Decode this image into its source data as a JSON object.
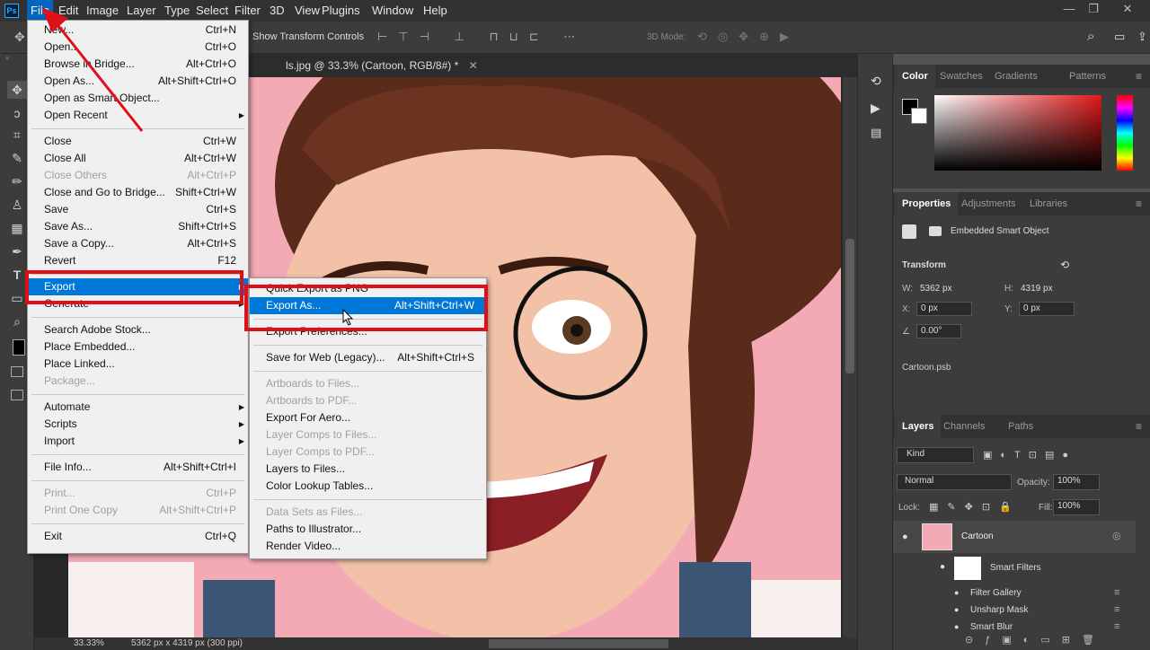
{
  "app": {
    "logo": "Ps"
  },
  "menubar": [
    "File",
    "Edit",
    "Image",
    "Layer",
    "Type",
    "Select",
    "Filter",
    "3D",
    "View",
    "Plugins",
    "Window",
    "Help"
  ],
  "window_controls": [
    "—",
    "❐",
    "✕"
  ],
  "options_bar": {
    "show_transform": "Show Transform Controls",
    "mode_3d": "3D Mode:"
  },
  "document": {
    "tab_title": "ls.jpg @ 33.3% (Cartoon, RGB/8#) *",
    "close": "✕"
  },
  "status": {
    "zoom": "33.33%",
    "info": "5362 px x 4319 px (300 ppi)"
  },
  "file_menu": [
    {
      "label": "New...",
      "shortcut": "Ctrl+N"
    },
    {
      "label": "Open...",
      "shortcut": "Ctrl+O"
    },
    {
      "label": "Browse in Bridge...",
      "shortcut": "Alt+Ctrl+O"
    },
    {
      "label": "Open As...",
      "shortcut": "Alt+Shift+Ctrl+O"
    },
    {
      "label": "Open as Smart Object...",
      "shortcut": ""
    },
    {
      "label": "Open Recent",
      "shortcut": "",
      "submenu": true
    },
    {
      "sep": true
    },
    {
      "label": "Close",
      "shortcut": "Ctrl+W"
    },
    {
      "label": "Close All",
      "shortcut": "Alt+Ctrl+W"
    },
    {
      "label": "Close Others",
      "shortcut": "Alt+Ctrl+P",
      "disabled": true
    },
    {
      "label": "Close and Go to Bridge...",
      "shortcut": "Shift+Ctrl+W"
    },
    {
      "label": "Save",
      "shortcut": "Ctrl+S"
    },
    {
      "label": "Save As...",
      "shortcut": "Shift+Ctrl+S"
    },
    {
      "label": "Save a Copy...",
      "shortcut": "Alt+Ctrl+S"
    },
    {
      "label": "Revert",
      "shortcut": "F12"
    },
    {
      "sep": true
    },
    {
      "label": "Export",
      "shortcut": "",
      "submenu": true,
      "highlighted": true
    },
    {
      "label": "Generate",
      "shortcut": "",
      "submenu": true
    },
    {
      "sep": true
    },
    {
      "label": "Search Adobe Stock...",
      "shortcut": ""
    },
    {
      "label": "Place Embedded...",
      "shortcut": ""
    },
    {
      "label": "Place Linked...",
      "shortcut": ""
    },
    {
      "label": "Package...",
      "shortcut": "",
      "disabled": true
    },
    {
      "sep": true
    },
    {
      "label": "Automate",
      "shortcut": "",
      "submenu": true
    },
    {
      "label": "Scripts",
      "shortcut": "",
      "submenu": true
    },
    {
      "label": "Import",
      "shortcut": "",
      "submenu": true
    },
    {
      "sep": true
    },
    {
      "label": "File Info...",
      "shortcut": "Alt+Shift+Ctrl+I"
    },
    {
      "sep": true
    },
    {
      "label": "Print...",
      "shortcut": "Ctrl+P",
      "disabled": true
    },
    {
      "label": "Print One Copy",
      "shortcut": "Alt+Shift+Ctrl+P",
      "disabled": true
    },
    {
      "sep": true
    },
    {
      "label": "Exit",
      "shortcut": "Ctrl+Q"
    }
  ],
  "export_menu": [
    {
      "label": "Quick Export as PNG",
      "shortcut": ""
    },
    {
      "label": "Export As...",
      "shortcut": "Alt+Shift+Ctrl+W",
      "highlighted": true
    },
    {
      "sep": true
    },
    {
      "label": "Export Preferences...",
      "shortcut": ""
    },
    {
      "sep": true
    },
    {
      "label": "Save for Web (Legacy)...",
      "shortcut": "Alt+Shift+Ctrl+S"
    },
    {
      "sep": true
    },
    {
      "label": "Artboards to Files...",
      "shortcut": "",
      "disabled": true
    },
    {
      "label": "Artboards to PDF...",
      "shortcut": "",
      "disabled": true
    },
    {
      "label": "Export For Aero...",
      "shortcut": ""
    },
    {
      "label": "Layer Comps to Files...",
      "shortcut": "",
      "disabled": true
    },
    {
      "label": "Layer Comps to PDF...",
      "shortcut": "",
      "disabled": true
    },
    {
      "label": "Layers to Files...",
      "shortcut": ""
    },
    {
      "label": "Color Lookup Tables...",
      "shortcut": ""
    },
    {
      "sep": true
    },
    {
      "label": "Data Sets as Files...",
      "shortcut": "",
      "disabled": true
    },
    {
      "label": "Paths to Illustrator...",
      "shortcut": ""
    },
    {
      "label": "Render Video...",
      "shortcut": ""
    }
  ],
  "color_panel": {
    "tabs": [
      "Color",
      "Swatches",
      "Gradients",
      "Patterns"
    ]
  },
  "properties_panel": {
    "tabs": [
      "Properties",
      "Adjustments",
      "Libraries"
    ],
    "type": "Embedded Smart Object",
    "transform_title": "Transform",
    "w_label": "W:",
    "w_value": "5362 px",
    "h_label": "H:",
    "h_value": "4319 px",
    "x_label": "X:",
    "x_value": "0 px",
    "y_label": "Y:",
    "y_value": "0 px",
    "angle_value": "0.00°",
    "file": "Cartoon.psb"
  },
  "layers_panel": {
    "tabs": [
      "Layers",
      "Channels",
      "Paths"
    ],
    "filter": "Kind",
    "blend_mode": "Normal",
    "opacity_label": "Opacity:",
    "opacity_value": "100%",
    "lock_label": "Lock:",
    "fill_label": "Fill:",
    "fill_value": "100%",
    "layer_name": "Cartoon",
    "smart_filters": "Smart Filters",
    "filters": [
      "Filter Gallery",
      "Unsharp Mask",
      "Smart Blur"
    ]
  },
  "colors": {
    "accent": "#0078d7",
    "annotation_red": "#e0101a",
    "canvas_bg": "#f4aab5"
  }
}
